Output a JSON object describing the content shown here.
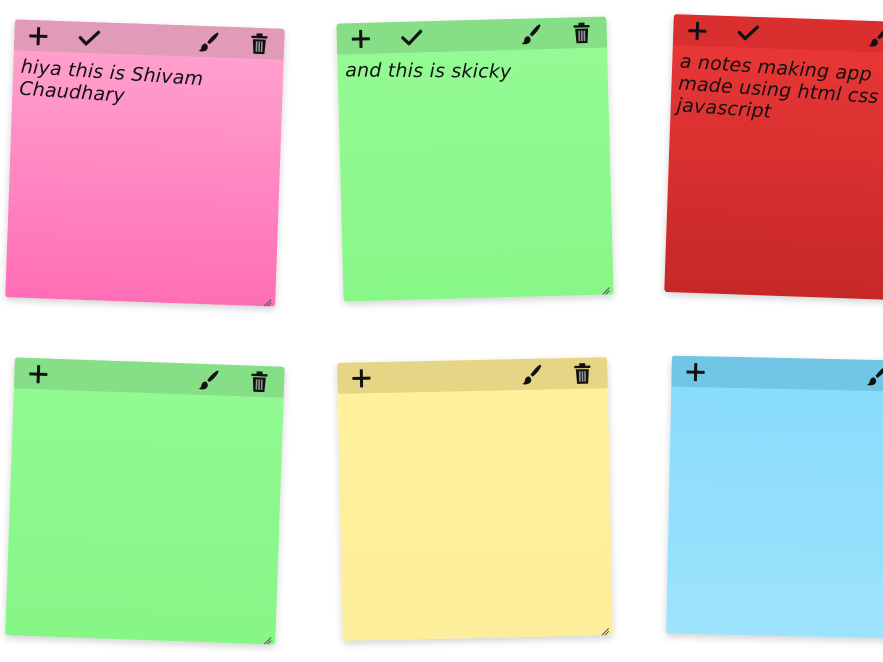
{
  "notes": [
    {
      "text": "hiya this is Shivam\nChaudhary",
      "show_check": true,
      "show_trash": true,
      "colors": {
        "bar": "#e19ab8",
        "top": "#ffa6d0",
        "bottom": "#ff6eb5"
      }
    },
    {
      "text": "and this is skicky",
      "show_check": true,
      "show_trash": true,
      "colors": {
        "bar": "#86df86",
        "top": "#96fb96",
        "bottom": "#87f787"
      }
    },
    {
      "text": "a notes making app\nmade using html css\njavascript",
      "show_check": true,
      "show_trash": false,
      "colors": {
        "bar": "#d92f2f",
        "top": "#ec3838",
        "bottom": "#c62828"
      }
    },
    {
      "text": "",
      "show_check": false,
      "show_trash": true,
      "colors": {
        "bar": "#86df86",
        "top": "#93fa93",
        "bottom": "#86f686"
      }
    },
    {
      "text": "",
      "show_check": false,
      "show_trash": true,
      "colors": {
        "bar": "#e6d585",
        "top": "#fff09c",
        "bottom": "#fdee9b"
      }
    },
    {
      "text": "",
      "show_check": false,
      "show_trash": false,
      "colors": {
        "bar": "#70c6e4",
        "top": "#86dbfb",
        "bottom": "#9ee3fd"
      }
    }
  ],
  "icons": {
    "add": "plus-icon",
    "check": "check-icon",
    "brush": "paintbrush-icon",
    "trash": "trash-icon",
    "resize": "resize-grip-icon"
  }
}
